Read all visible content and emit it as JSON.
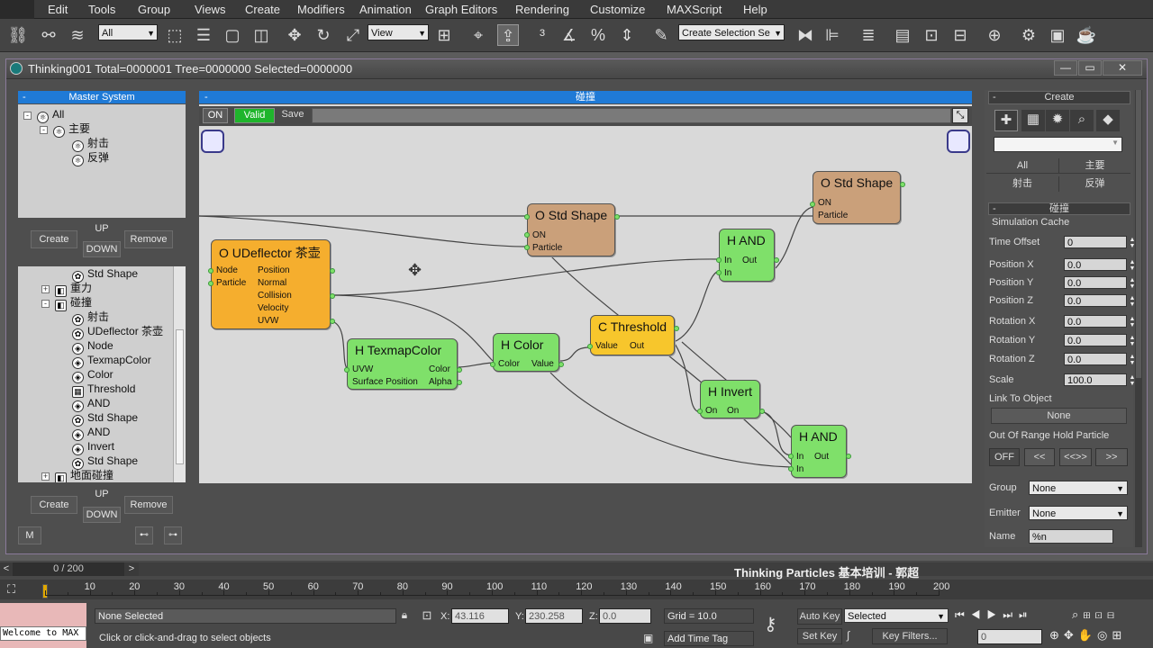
{
  "menubar": {
    "items": [
      "Edit",
      "Tools",
      "Group",
      "Views",
      "Create",
      "Modifiers",
      "Animation",
      "Graph Editors",
      "Rendering",
      "Customize",
      "MAXScript",
      "Help"
    ]
  },
  "toolbar": {
    "filter_select": "All",
    "view_select": "View",
    "selection_set_placeholder": "Create Selection Se"
  },
  "window": {
    "title": "Thinking001  Total=0000001  Tree=0000000  Selected=0000000",
    "min": "—",
    "max": "▭",
    "close": "✕"
  },
  "master": {
    "header": "Master System",
    "collapse": "-",
    "tree": [
      {
        "label": "All"
      },
      {
        "label": "主要"
      },
      {
        "label": "射击"
      },
      {
        "label": "反弹"
      }
    ],
    "btn_create": "Create",
    "btn_up": "UP",
    "btn_down": "DOWN",
    "btn_remove": "Remove"
  },
  "dyn": {
    "tree": [
      {
        "label": "Std Shape"
      },
      {
        "label": "重力"
      },
      {
        "label": "碰撞"
      },
      {
        "label": "射击"
      },
      {
        "label": "UDeflector 茶壶"
      },
      {
        "label": "Node"
      },
      {
        "label": "TexmapColor"
      },
      {
        "label": "Color"
      },
      {
        "label": "Threshold"
      },
      {
        "label": "AND"
      },
      {
        "label": "Std Shape"
      },
      {
        "label": "AND"
      },
      {
        "label": "Invert"
      },
      {
        "label": "Std Shape"
      },
      {
        "label": "地面碰撞"
      }
    ],
    "btn_create": "Create",
    "btn_up": "UP",
    "btn_down": "DOWN",
    "btn_remove": "Remove",
    "btn_m": "M"
  },
  "canvas": {
    "header": "碰撞",
    "collapse": "-",
    "btn_on": "ON",
    "btn_valid": "Valid",
    "btn_save": "Save",
    "nodes": {
      "udeflector": {
        "title": "O UDeflector 茶壶",
        "in": [
          "Node",
          "Particle"
        ],
        "out": [
          "Position",
          "Normal",
          "Collision",
          "Velocity",
          "UVW"
        ]
      },
      "std1": {
        "title": "O Std Shape",
        "in": [
          "ON",
          "Particle"
        ]
      },
      "std2": {
        "title": "O Std Shape",
        "in": [
          "ON",
          "Particle"
        ]
      },
      "texmap": {
        "title": "H TexmapColor",
        "in": [
          "UVW",
          "Surface Position"
        ],
        "out": [
          "Color",
          "Alpha"
        ]
      },
      "color": {
        "title": "H Color",
        "in": [
          "Color"
        ],
        "out": [
          "Value"
        ]
      },
      "threshold": {
        "title": "C Threshold",
        "in": [
          "Value"
        ],
        "out": [
          "Out"
        ]
      },
      "and1": {
        "title": "H AND",
        "in": [
          "In",
          "In"
        ],
        "out": [
          "Out"
        ]
      },
      "invert": {
        "title": "H Invert",
        "in": [
          "On"
        ],
        "out": [
          "On"
        ]
      },
      "and2": {
        "title": "H AND",
        "in": [
          "In",
          "In"
        ],
        "out": [
          "Out"
        ]
      }
    }
  },
  "rpanel": {
    "create_header": "Create",
    "collapse": "-",
    "filters": [
      "All",
      "主要",
      "射击",
      "反弹"
    ],
    "node_header": "碰撞",
    "sim_cache": "Simulation Cache",
    "params": [
      {
        "label": "Time Offset",
        "value": "0"
      },
      {
        "label": "Position X",
        "value": "0.0"
      },
      {
        "label": "Position Y",
        "value": "0.0"
      },
      {
        "label": "Position Z",
        "value": "0.0"
      },
      {
        "label": "Rotation X",
        "value": "0.0"
      },
      {
        "label": "Rotation Y",
        "value": "0.0"
      },
      {
        "label": "Rotation Z",
        "value": "0.0"
      },
      {
        "label": "Scale",
        "value": "100.0"
      }
    ],
    "link_to_object": "Link To Object",
    "none_btn": "None",
    "out_of_range": "Out Of Range Hold Particle",
    "range_btns": [
      "OFF",
      "<<",
      "<<>>",
      ">>"
    ],
    "group_label": "Group",
    "group_value": "None",
    "emitter_label": "Emitter",
    "emitter_value": "None",
    "name_label": "Name",
    "name_value": "%n"
  },
  "timeline": {
    "frame": "0 / 200",
    "prev": "<",
    "next": ">",
    "course_title": "Thinking Particles 基本培训 - 郭超",
    "ticks": [
      "0",
      "10",
      "20",
      "30",
      "40",
      "50",
      "60",
      "70",
      "80",
      "90",
      "100",
      "110",
      "120",
      "130",
      "140",
      "150",
      "160",
      "170",
      "180",
      "190",
      "200"
    ]
  },
  "status": {
    "welcome": "Welcome to MAX",
    "selected": "None Selected",
    "hint": "Click or click-and-drag to select objects",
    "x_label": "X:",
    "x_value": "43.116",
    "y_label": "Y:",
    "y_value": "230.258",
    "z_label": "Z:",
    "z_value": "0.0",
    "grid": "Grid = 10.0",
    "add_time_tag": "Add Time Tag",
    "auto_key": "Auto Key",
    "set_key": "Set Key",
    "key_select": "Selected",
    "key_filters": "Key Filters...",
    "frame_field": "0"
  }
}
